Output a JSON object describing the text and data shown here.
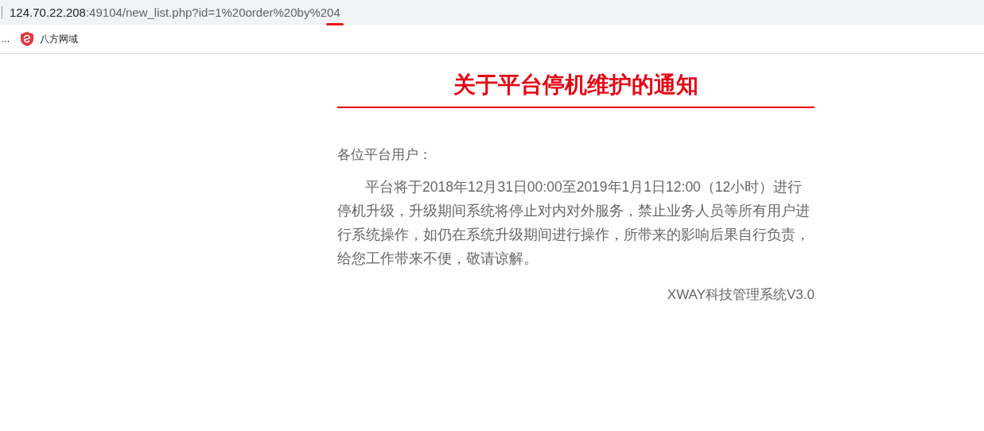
{
  "address_bar": {
    "host": "124.70.22.208",
    "path": ":49104/new_list.php?id=1%20order%20by%204",
    "marked": true
  },
  "bookmarks": [
    {
      "label": "...",
      "kind": "text"
    },
    {
      "label": "八方网域",
      "kind": "shield"
    }
  ],
  "notice": {
    "title": "关于平台停机维护的通知",
    "greeting": "各位平台用户：",
    "body": "平台将于2018年12月31日00:00至2019年1月1日12:00（12小时）进行停机升级，升级期间系统将停止对内对外服务，禁止业务人员等所有用户进行系统操作，如仍在系统升级期间进行操作，所带来的影响后果自行负责，给您工作带来不便，敬请谅解。",
    "signature": "XWAY科技管理系统V3.0"
  }
}
